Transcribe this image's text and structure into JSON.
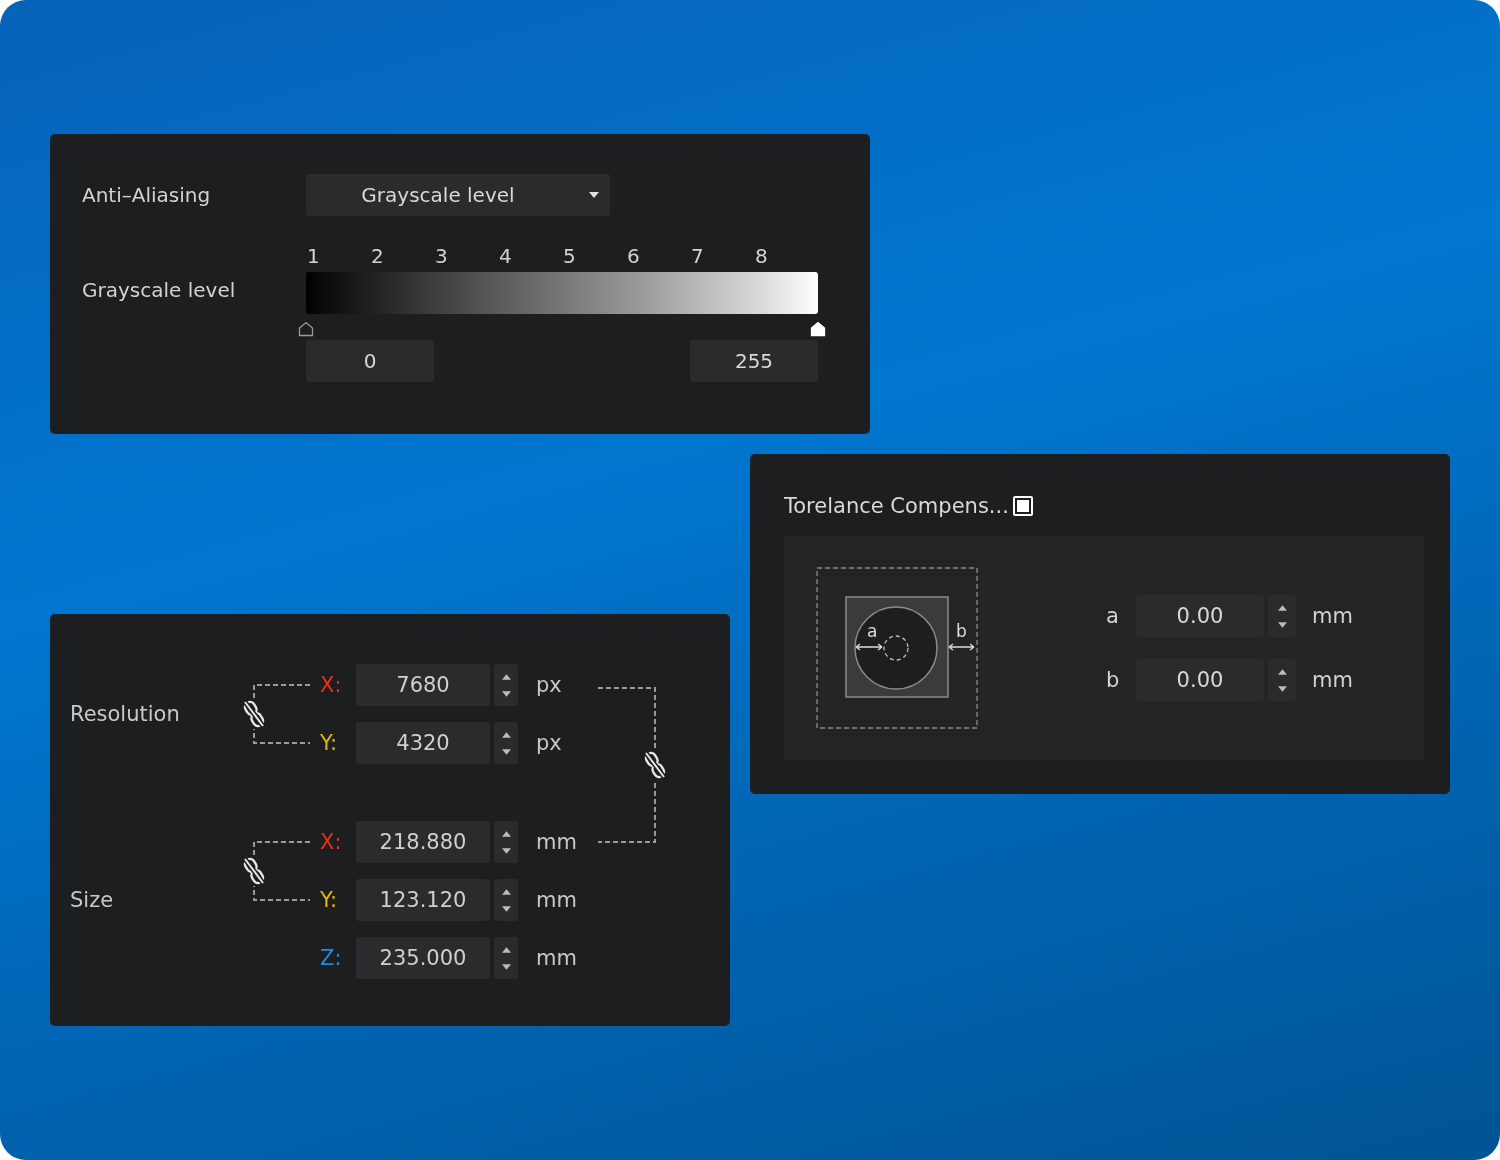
{
  "anti_aliasing": {
    "label": "Anti–Aliasing",
    "dropdown": {
      "value": "Grayscale level"
    }
  },
  "grayscale": {
    "label": "Grayscale level",
    "ticks": [
      "1",
      "2",
      "3",
      "4",
      "5",
      "6",
      "7",
      "8"
    ],
    "thumbs": [
      {
        "level": 0,
        "selected": false
      },
      {
        "level": 1,
        "selected": true
      }
    ],
    "low_value": "0",
    "high_value": "255"
  },
  "dimensions": {
    "groups": [
      {
        "label": "Resolution",
        "rows": [
          {
            "axis": "X:",
            "color": "#e8301c",
            "value": "7680",
            "unit": "px"
          },
          {
            "axis": "Y:",
            "color": "#e0b400",
            "value": "4320",
            "unit": "px"
          }
        ]
      },
      {
        "label": "Size",
        "rows": [
          {
            "axis": "X:",
            "color": "#e8301c",
            "value": "218.880",
            "unit": "mm"
          },
          {
            "axis": "Y:",
            "color": "#e0b400",
            "value": "123.120",
            "unit": "mm"
          },
          {
            "axis": "Z:",
            "color": "#1e8ce0",
            "value": "235.000",
            "unit": "mm"
          }
        ]
      }
    ]
  },
  "tolerance": {
    "title": "Torelance Compens...",
    "checked": true,
    "diagram_labels": [
      "a",
      "b"
    ],
    "fields": [
      {
        "label": "a",
        "value": "0.00",
        "unit": "mm"
      },
      {
        "label": "b",
        "value": "0.00",
        "unit": "mm"
      }
    ]
  }
}
